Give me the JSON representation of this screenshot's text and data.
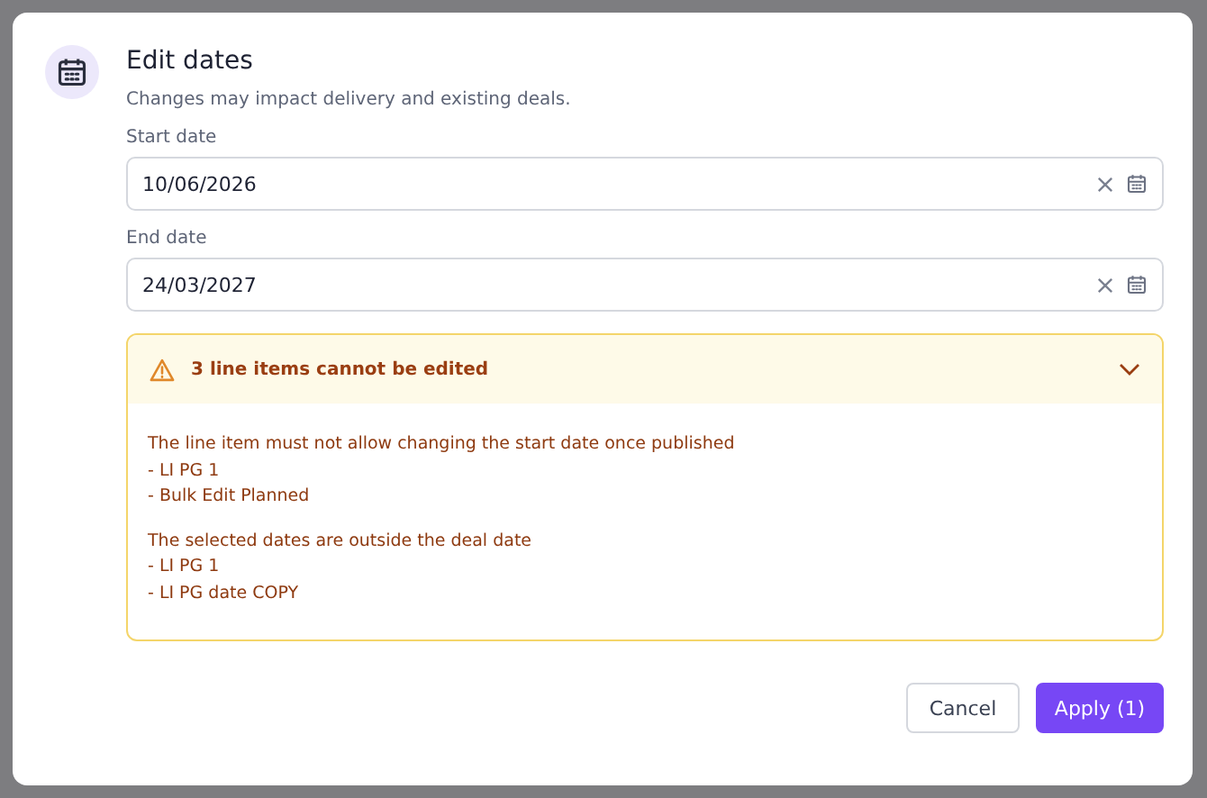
{
  "dialog": {
    "title": "Edit dates",
    "subtitle": "Changes may impact delivery and existing deals.",
    "fields": [
      {
        "label": "Start date",
        "value": "10/06/2026"
      },
      {
        "label": "End date",
        "value": "24/03/2027"
      }
    ],
    "warning": {
      "title": "3 line items cannot be edited",
      "expanded": true,
      "groups": [
        {
          "message": "The line item must not allow changing the start date once published",
          "items": [
            "- LI PG 1",
            "- Bulk Edit Planned"
          ]
        },
        {
          "message": "The selected dates are outside the deal date",
          "items": [
            "- LI PG 1",
            "- LI PG date COPY"
          ]
        }
      ]
    },
    "buttons": [
      {
        "label": "Cancel",
        "kind": "secondary"
      },
      {
        "label": "Apply (1)",
        "kind": "primary"
      }
    ]
  }
}
